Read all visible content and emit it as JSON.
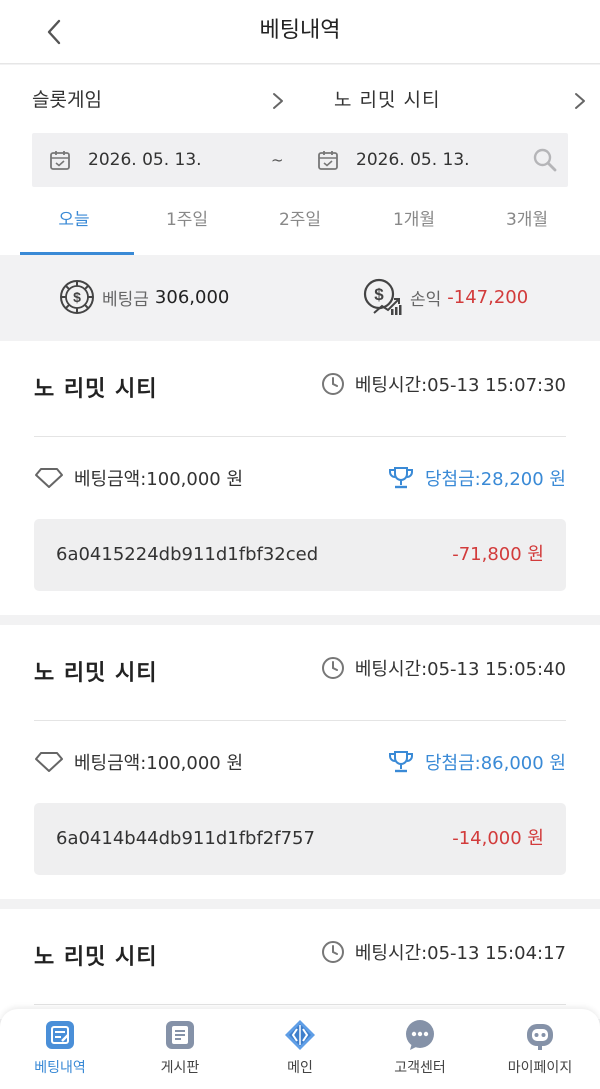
{
  "header": {
    "title": "베팅내역"
  },
  "filter": {
    "game_type": "슬롯게임",
    "selected_game": "노 리밋 시티",
    "date_start": "2026. 05. 13.",
    "date_separator": "~",
    "date_end": "2026. 05. 13."
  },
  "tabs": [
    {
      "label": "오늘",
      "active": true
    },
    {
      "label": "1주일",
      "active": false
    },
    {
      "label": "2주일",
      "active": false
    },
    {
      "label": "1개월",
      "active": false
    },
    {
      "label": "3개월",
      "active": false
    }
  ],
  "summary": {
    "bet_label": "베팅금",
    "bet_value": "306,000",
    "pnl_label": "손익",
    "pnl_value": "-147,200"
  },
  "records": [
    {
      "game": "노 리밋 시티",
      "time": "베팅시간:05-13 15:07:30",
      "bet": "베팅금액:100,000 원",
      "win": "당첨금:28,200 원",
      "hash": "6a0415224db911d1fbf32ced",
      "pnl": "-71,800 원"
    },
    {
      "game": "노 리밋 시티",
      "time": "베팅시간:05-13 15:05:40",
      "bet": "베팅금액:100,000 원",
      "win": "당첨금:86,000 원",
      "hash": "6a0414b44db911d1fbf2f757",
      "pnl": "-14,000 원"
    },
    {
      "game": "노 리밋 시티",
      "time": "베팅시간:05-13 15:04:17"
    }
  ],
  "bottom_nav": [
    {
      "label": "베팅내역",
      "icon": "bet-history-icon",
      "active": true
    },
    {
      "label": "게시판",
      "icon": "board-icon",
      "active": false
    },
    {
      "label": "메인",
      "icon": "main-icon",
      "active": false
    },
    {
      "label": "고객센터",
      "icon": "chat-icon",
      "active": false
    },
    {
      "label": "마이페이지",
      "icon": "robot-icon",
      "active": false
    }
  ],
  "colors": {
    "accent": "#3a8ad6",
    "negative": "#d23b3b"
  }
}
